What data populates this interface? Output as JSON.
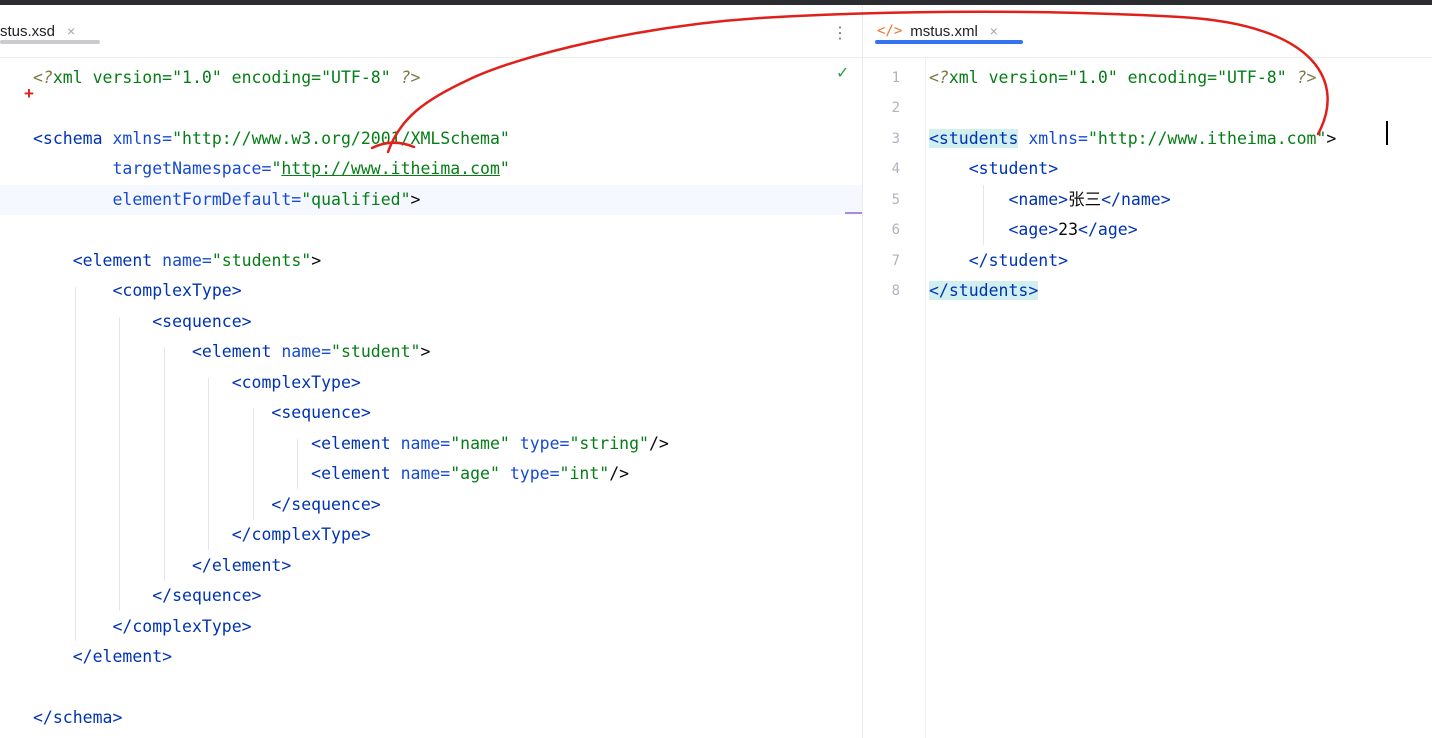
{
  "tabs": {
    "left": {
      "label": "stus.xsd",
      "close": "×"
    },
    "right": {
      "label": "mstus.xml",
      "close": "×",
      "icon": "xml-file-icon",
      "icon_glyph": "</>"
    }
  },
  "xsd": {
    "l1": {
      "p1": "<?",
      "p2": "xml version=\"1.0\" encoding=\"UTF-8\" ",
      "p3": "?>"
    },
    "l3": {
      "tag": "<schema",
      "attr": " xmlns=",
      "val": "\"http://www.w3.org/2001/XMLSchema\""
    },
    "l4": {
      "attr": "targetNamespace=",
      "q1": "\"",
      "url": "http://www.itheima.com",
      "q2": "\""
    },
    "l5": {
      "attr": "elementFormDefault=",
      "val": "\"qualified\"",
      "close": ">"
    },
    "l7": {
      "tag": "<element",
      "attr": " name=",
      "val": "\"students\"",
      "close": ">"
    },
    "l8": "<complexType>",
    "l9": "<sequence>",
    "l10": {
      "tag": "<element",
      "attr": " name=",
      "val": "\"student\"",
      "close": ">"
    },
    "l11": "<complexType>",
    "l12": "<sequence>",
    "l13": {
      "tag": "<element",
      "a1": " name=",
      "v1": "\"name\"",
      "a2": " type=",
      "v2": "\"string\"",
      "close": "/>"
    },
    "l14": {
      "tag": "<element",
      "a1": " name=",
      "v1": "\"age\"",
      "a2": " type=",
      "v2": "\"int\"",
      "close": "/>"
    },
    "l15": "</sequence>",
    "l16": "</complexType>",
    "l17": "</element>",
    "l18": "</sequence>",
    "l19": "</complexType>",
    "l20": "</element>",
    "l22": "</schema>"
  },
  "xml": {
    "line_numbers": [
      "1",
      "2",
      "3",
      "4",
      "5",
      "6",
      "7",
      "8"
    ],
    "l1": {
      "p1": "<?",
      "p2": "xml version=\"1.0\" encoding=\"UTF-8\" ",
      "p3": "?>"
    },
    "l3": {
      "tag": "<students",
      "attr": " xmlns=",
      "val": "\"http://www.itheima.com\"",
      "close": ">"
    },
    "l4": "<student>",
    "l5": {
      "open": "<name>",
      "text": "张三",
      "close": "</name>"
    },
    "l6": {
      "open": "<age>",
      "text": "23",
      "close": "</age>"
    },
    "l7": "</student>",
    "l8": "</students>"
  },
  "status": {
    "check": "✓",
    "plus": "+",
    "more": "⋮"
  },
  "colors": {
    "tag": "#0033b3",
    "attr": "#174ad4",
    "value": "#067d17",
    "annotation": "#e0201a",
    "tab_active": "#3574f0"
  }
}
